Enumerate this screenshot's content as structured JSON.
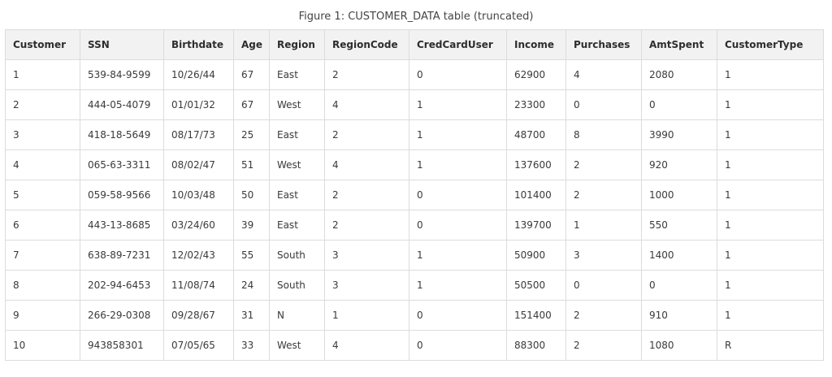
{
  "caption": "Figure 1: CUSTOMER_DATA table (truncated)",
  "table": {
    "headers": [
      "Customer",
      "SSN",
      "Birthdate",
      "Age",
      "Region",
      "RegionCode",
      "CredCardUser",
      "Income",
      "Purchases",
      "AmtSpent",
      "CustomerType"
    ],
    "rows": [
      [
        "1",
        "539-84-9599",
        "10/26/44",
        "67",
        "East",
        "2",
        "0",
        "62900",
        "4",
        "2080",
        "1"
      ],
      [
        "2",
        "444-05-4079",
        "01/01/32",
        "67",
        "West",
        "4",
        "1",
        "23300",
        "0",
        "0",
        "1"
      ],
      [
        "3",
        "418-18-5649",
        "08/17/73",
        "25",
        "East",
        "2",
        "1",
        "48700",
        "8",
        "3990",
        "1"
      ],
      [
        "4",
        "065-63-3311",
        "08/02/47",
        "51",
        "West",
        "4",
        "1",
        "137600",
        "2",
        "920",
        "1"
      ],
      [
        "5",
        "059-58-9566",
        "10/03/48",
        "50",
        "East",
        "2",
        "0",
        "101400",
        "2",
        "1000",
        "1"
      ],
      [
        "6",
        "443-13-8685",
        "03/24/60",
        "39",
        "East",
        "2",
        "0",
        "139700",
        "1",
        "550",
        "1"
      ],
      [
        "7",
        "638-89-7231",
        "12/02/43",
        "55",
        "South",
        "3",
        "1",
        "50900",
        "3",
        "1400",
        "1"
      ],
      [
        "8",
        "202-94-6453",
        "11/08/74",
        "24",
        "South",
        "3",
        "1",
        "50500",
        "0",
        "0",
        "1"
      ],
      [
        "9",
        "266-29-0308",
        "09/28/67",
        "31",
        "N",
        "1",
        "0",
        "151400",
        "2",
        "910",
        "1"
      ],
      [
        "10",
        "943858301",
        "07/05/65",
        "33",
        "West",
        "4",
        "0",
        "88300",
        "2",
        "1080",
        "R"
      ]
    ]
  }
}
